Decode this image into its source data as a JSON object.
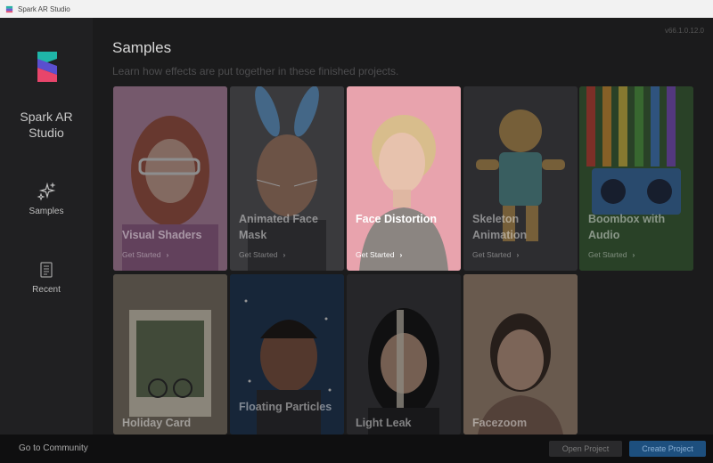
{
  "window": {
    "title": "Spark AR Studio"
  },
  "sidebar": {
    "brand_line1": "Spark AR",
    "brand_line2": "Studio",
    "items": [
      {
        "label": "Samples",
        "icon": "sparkles-icon"
      },
      {
        "label": "Recent",
        "icon": "document-icon"
      }
    ]
  },
  "main": {
    "version": "v66.1.0.12.0",
    "title": "Samples",
    "subtitle": "Learn how effects are put together in these finished projects.",
    "get_started": "Get Started",
    "cards": [
      {
        "name": "Visual Shaders",
        "color": "#d9a6c6"
      },
      {
        "name": "Animated Face Mask",
        "color": "#7a7a7e"
      },
      {
        "name": "Face Distortion",
        "color": "#e8a3ad"
      },
      {
        "name": "Skeleton Animation",
        "color": "#4a4a4e"
      },
      {
        "name": "Boombox with Audio",
        "color": "#3f6b3a"
      },
      {
        "name": "Holiday Card",
        "color": "#a69a7e"
      },
      {
        "name": "Floating Particles",
        "color": "#1e3a5a"
      },
      {
        "name": "Light Leak",
        "color": "#3a3a3c"
      },
      {
        "name": "Facezoom",
        "color": "#b39780"
      }
    ]
  },
  "footer": {
    "community": "Go to Community",
    "open_project": "Open Project",
    "create_project": "Create Project"
  },
  "colors": {
    "accent": "#1d4f7e",
    "active_card": "#e8a3ad"
  }
}
